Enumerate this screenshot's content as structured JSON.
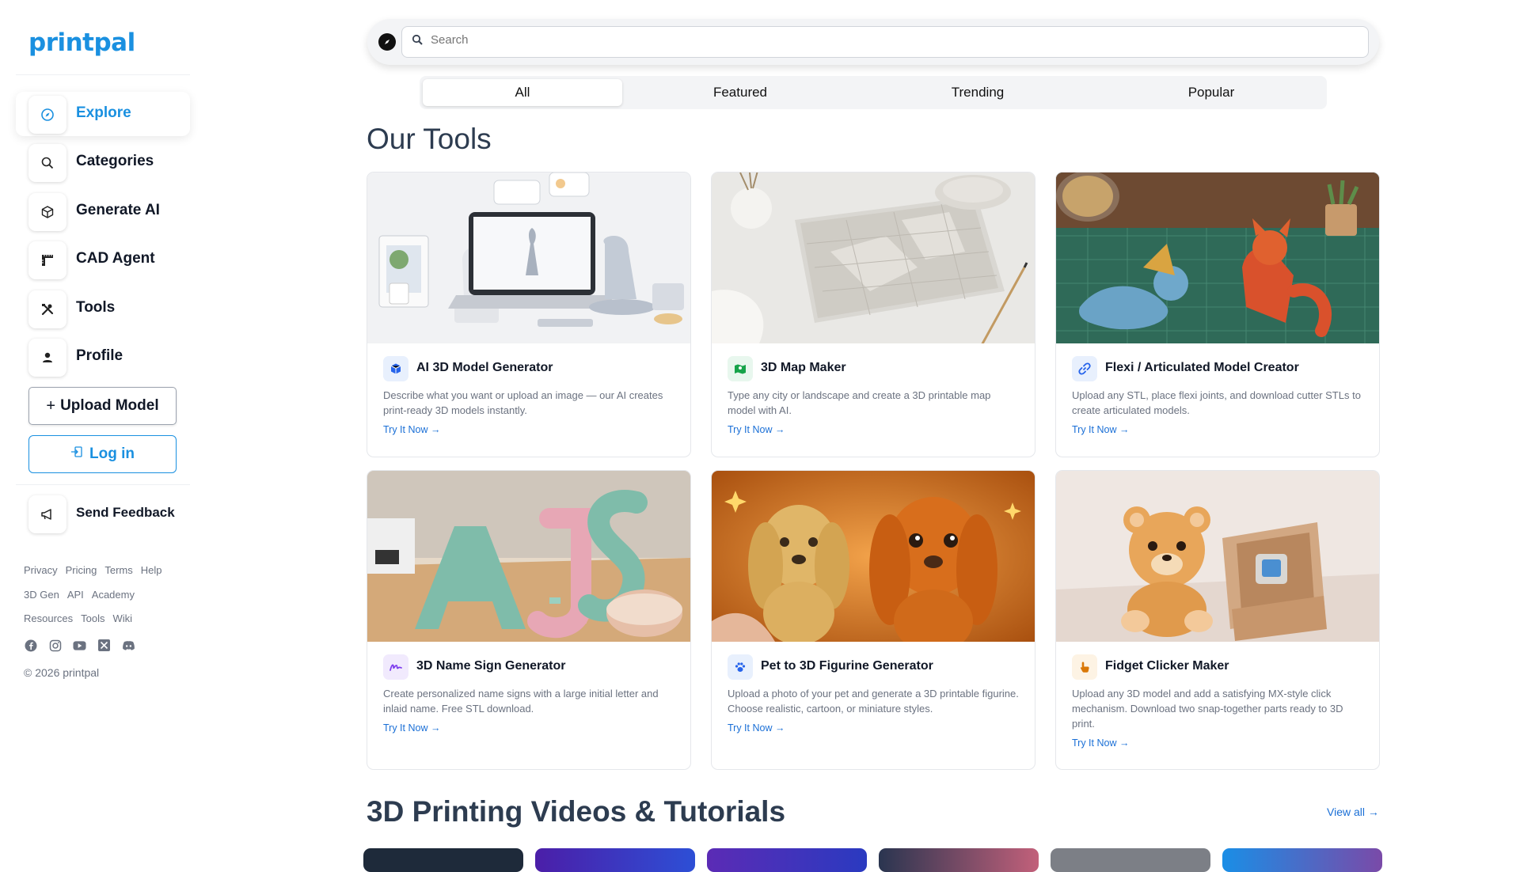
{
  "sidebar": {
    "logo": "printpal",
    "items": [
      {
        "label": "Explore",
        "icon": "compass-icon"
      },
      {
        "label": "Categories",
        "icon": "search-icon"
      },
      {
        "label": "Generate AI",
        "icon": "cube-icon"
      },
      {
        "label": "CAD Agent",
        "icon": "ruler-icon"
      },
      {
        "label": "Tools",
        "icon": "tools-icon"
      },
      {
        "label": "Profile",
        "icon": "user-icon"
      }
    ],
    "upload_label": "Upload Model",
    "login_label": "Log in",
    "feedback_label": "Send Feedback",
    "footer_row1": [
      "Privacy",
      "Pricing",
      "Terms",
      "Help"
    ],
    "footer_row2": [
      "3D Gen",
      "API",
      "Academy"
    ],
    "footer_row3": [
      "Resources",
      "Tools",
      "Wiki"
    ],
    "social": [
      "facebook-icon",
      "instagram-icon",
      "youtube-icon",
      "x-icon",
      "discord-icon"
    ],
    "copyright": "© 2026 printpal"
  },
  "search": {
    "placeholder": "Search"
  },
  "tabs": [
    "All",
    "Featured",
    "Trending",
    "Popular"
  ],
  "section_title": "Our Tools",
  "cards": [
    {
      "title": "AI 3D Model Generator",
      "desc": "Describe what you want or upload an image — our AI creates print-ready 3D models instantly.",
      "link": "Try It Now →",
      "icon": "cube-icon",
      "icon_color": "#2563eb",
      "icon_bg": "#e8f0fd"
    },
    {
      "title": "3D Map Maker",
      "desc": "Type any city or landscape and create a 3D printable map model with AI.",
      "link": "Try It Now →",
      "icon": "map-icon",
      "icon_color": "#16a34a",
      "icon_bg": "#e8f7ee"
    },
    {
      "title": "Flexi / Articulated Model Creator",
      "desc": "Upload any STL, place flexi joints, and download cutter STLs to create articulated models.",
      "link": "Try It Now →",
      "icon": "link-icon",
      "icon_color": "#2563eb",
      "icon_bg": "#e8f0fd"
    },
    {
      "title": "3D Name Sign Generator",
      "desc": "Create personalized name signs with a large initial letter and inlaid name. Free STL download.",
      "link": "Try It Now →",
      "icon": "signature-icon",
      "icon_color": "#7c3aed",
      "icon_bg": "#f1eafd"
    },
    {
      "title": "Pet to 3D Figurine Generator",
      "desc": "Upload a photo of your pet and generate a 3D printable figurine. Choose realistic, cartoon, or miniature styles.",
      "link": "Try It Now →",
      "icon": "paw-icon",
      "icon_color": "#2563eb",
      "icon_bg": "#e8f0fd"
    },
    {
      "title": "Fidget Clicker Maker",
      "desc": "Upload any 3D model and add a satisfying MX-style click mechanism. Download two snap-together parts ready to 3D print.",
      "link": "Try It Now →",
      "icon": "pointer-icon",
      "icon_color": "#d97706",
      "icon_bg": "#fdf3e4"
    }
  ],
  "videos_title": "3D Printing Videos & Tutorials",
  "view_all": "View all →",
  "colors": {
    "accent": "#1a90e0",
    "link": "#1a6fd6",
    "heading": "#2d3c50"
  }
}
